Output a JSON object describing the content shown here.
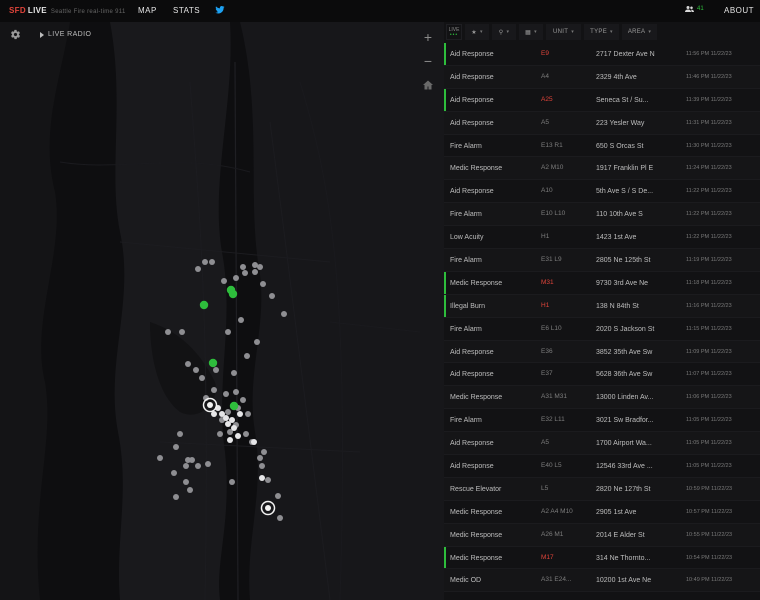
{
  "header": {
    "brand_sfd": "SFD",
    "brand_live": "LIVE",
    "brand_sub": "Seattle Fire real-time 911",
    "nav_map": "MAP",
    "nav_stats": "STATS",
    "twitter_icon": "twitter-bird-icon",
    "users_icon": "users-icon",
    "users_count": "41",
    "about": "ABOUT"
  },
  "map": {
    "settings_icon": "gear-icon",
    "radio_label": "LIVE RADIO",
    "zoom_in": "+",
    "zoom_out": "−",
    "home_icon": "home-icon"
  },
  "filters": {
    "live_label": "LIVE",
    "star_icon": "star-icon",
    "pin_icon": "map-pin-icon",
    "calendar_icon": "calendar-icon",
    "unit_label": "UNIT",
    "type_label": "TYPE",
    "area_label": "AREA"
  },
  "colors": {
    "accent_green": "#2ebd3c",
    "accent_red": "#e0443a"
  },
  "incidents": [
    {
      "type": "Aid Response",
      "unit": "E9",
      "address": "2717 Dexter Ave N",
      "time": "11:56 PM 11/22/23",
      "active": true,
      "unit_red": true
    },
    {
      "type": "Aid Response",
      "unit": "A4",
      "address": "2329 4th Ave",
      "time": "11:46 PM 11/22/23",
      "active": false,
      "unit_red": false
    },
    {
      "type": "Aid Response",
      "unit": "A25",
      "address": "Seneca St / Su...",
      "time": "11:39 PM 11/22/23",
      "active": true,
      "unit_red": true
    },
    {
      "type": "Aid Response",
      "unit": "A5",
      "address": "223 Yesler Way",
      "time": "11:31 PM 11/22/23",
      "active": false,
      "unit_red": false
    },
    {
      "type": "Fire Alarm",
      "unit": "E13 R1",
      "address": "650 S Orcas St",
      "time": "11:30 PM 11/22/23",
      "active": false,
      "unit_red": false
    },
    {
      "type": "Medic Response",
      "unit": "A2 M10",
      "address": "1917 Franklin Pl E",
      "time": "11:24 PM 11/22/23",
      "active": false,
      "unit_red": false
    },
    {
      "type": "Aid Response",
      "unit": "A10",
      "address": "5th Ave S / S De...",
      "time": "11:22 PM 11/22/23",
      "active": false,
      "unit_red": false
    },
    {
      "type": "Fire Alarm",
      "unit": "E10 L10",
      "address": "110 10th Ave S",
      "time": "11:22 PM 11/22/23",
      "active": false,
      "unit_red": false
    },
    {
      "type": "Low Acuity",
      "unit": "H1",
      "address": "1423 1st Ave",
      "time": "11:22 PM 11/22/23",
      "active": false,
      "unit_red": false
    },
    {
      "type": "Fire Alarm",
      "unit": "E31 L9",
      "address": "2805 Ne 125th St",
      "time": "11:19 PM 11/22/23",
      "active": false,
      "unit_red": false
    },
    {
      "type": "Medic Response",
      "unit": "M31",
      "address": "9730 3rd Ave Ne",
      "time": "11:18 PM 11/22/23",
      "active": true,
      "unit_red": true
    },
    {
      "type": "Illegal Burn",
      "unit": "H1",
      "address": "138 N 84th St",
      "time": "11:16 PM 11/22/23",
      "active": true,
      "unit_red": true
    },
    {
      "type": "Fire Alarm",
      "unit": "E6 L10",
      "address": "2020 S Jackson St",
      "time": "11:15 PM 11/22/23",
      "active": false,
      "unit_red": false
    },
    {
      "type": "Aid Response",
      "unit": "E36",
      "address": "3852 35th Ave Sw",
      "time": "11:09 PM 11/22/23",
      "active": false,
      "unit_red": false
    },
    {
      "type": "Aid Response",
      "unit": "E37",
      "address": "5628 36th Ave Sw",
      "time": "11:07 PM 11/22/23",
      "active": false,
      "unit_red": false
    },
    {
      "type": "Medic Response",
      "unit": "A31 M31",
      "address": "13000 Linden Av...",
      "time": "11:06 PM 11/22/23",
      "active": false,
      "unit_red": false
    },
    {
      "type": "Fire Alarm",
      "unit": "E32 L11",
      "address": "3021 Sw Bradfor...",
      "time": "11:05 PM 11/22/23",
      "active": false,
      "unit_red": false
    },
    {
      "type": "Aid Response",
      "unit": "A5",
      "address": "1700 Airport Wa...",
      "time": "11:05 PM 11/22/23",
      "active": false,
      "unit_red": false
    },
    {
      "type": "Aid Response",
      "unit": "E40 L5",
      "address": "12546 33rd Ave ...",
      "time": "11:05 PM 11/22/23",
      "active": false,
      "unit_red": false
    },
    {
      "type": "Rescue Elevator",
      "unit": "L5",
      "address": "2820 Ne 127th St",
      "time": "10:59 PM 11/22/23",
      "active": false,
      "unit_red": false
    },
    {
      "type": "Medic Response",
      "unit": "A2 A4 M10",
      "address": "2905 1st Ave",
      "time": "10:57 PM 11/22/23",
      "active": false,
      "unit_red": false
    },
    {
      "type": "Medic Response",
      "unit": "A26 M1",
      "address": "2014 E Alder St",
      "time": "10:55 PM 11/22/23",
      "active": false,
      "unit_red": false
    },
    {
      "type": "Medic Response",
      "unit": "M17",
      "address": "314 Ne Thornto...",
      "time": "10:54 PM 11/22/23",
      "active": true,
      "unit_red": true
    },
    {
      "type": "Medic OD",
      "unit": "A31 E24...",
      "address": "10200 1st Ave Ne",
      "time": "10:49 PM 11/22/23",
      "active": false,
      "unit_red": false
    }
  ]
}
